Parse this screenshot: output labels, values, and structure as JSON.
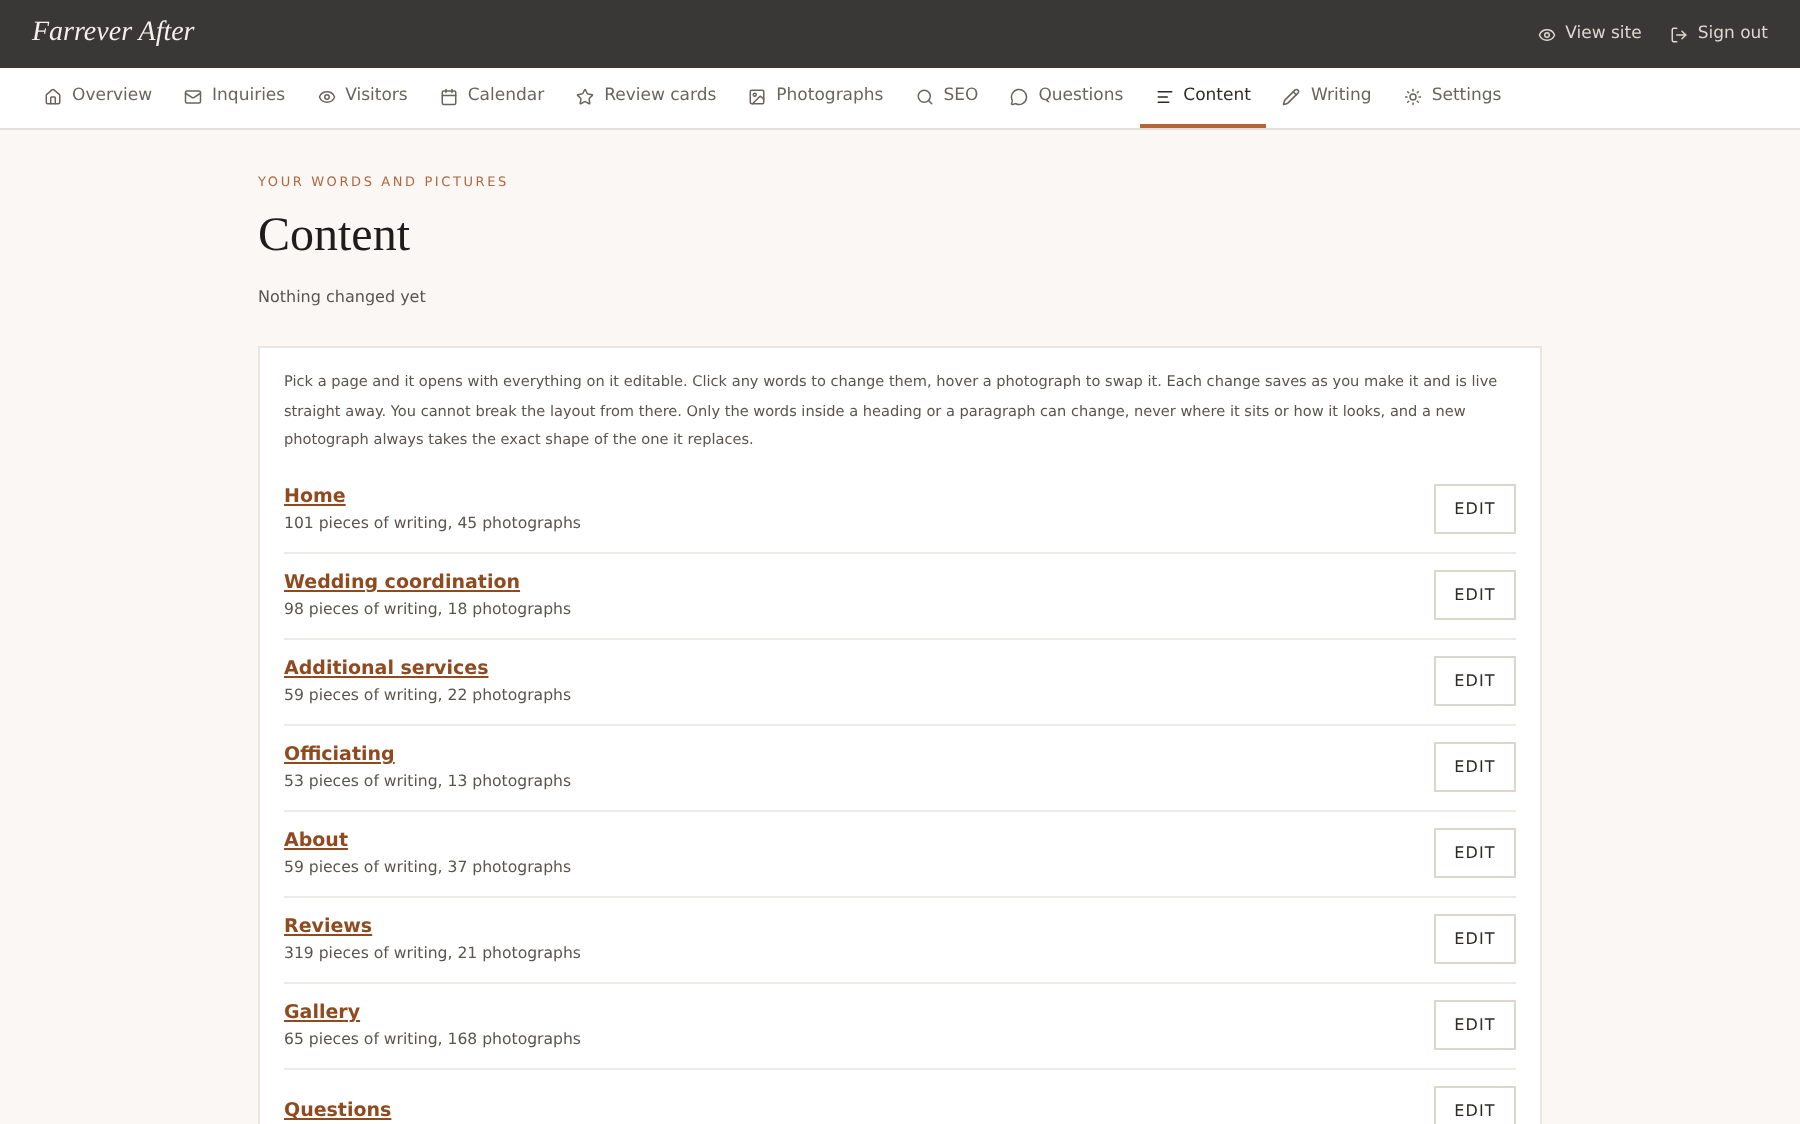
{
  "header": {
    "brand": "Farrever After",
    "links": [
      {
        "kind": "view",
        "label": "View site"
      },
      {
        "kind": "signout",
        "label": "Sign out"
      }
    ]
  },
  "tabs": [
    {
      "kind": "home",
      "label": "Overview",
      "selected": false
    },
    {
      "kind": "mail",
      "label": "Inquiries",
      "selected": false
    },
    {
      "kind": "eye",
      "label": "Visitors",
      "selected": false
    },
    {
      "kind": "calendar",
      "label": "Calendar",
      "selected": false
    },
    {
      "kind": "star",
      "label": "Review cards",
      "selected": false
    },
    {
      "kind": "image",
      "label": "Photographs",
      "selected": false
    },
    {
      "kind": "search",
      "label": "SEO",
      "selected": false
    },
    {
      "kind": "message",
      "label": "Questions",
      "selected": false
    },
    {
      "kind": "lines",
      "label": "Content",
      "selected": true
    },
    {
      "kind": "pencil",
      "label": "Writing",
      "selected": false
    },
    {
      "kind": "settings",
      "label": "Settings",
      "selected": false
    }
  ],
  "page": {
    "eyebrow": "YOUR WORDS AND PICTURES",
    "title": "Content",
    "status": "Nothing changed yet"
  },
  "intro": "Pick a page and it opens with everything on it editable. Click any words to change them, hover a photograph to swap it. Each change saves as you make it and is live straight away. You cannot break the layout from there. Only the words inside a heading or a paragraph can change, never where it sits or how it looks, and a new photograph always takes the exact shape of the one it replaces.",
  "pages": [
    {
      "name": "Home",
      "summary": "101 pieces of writing, 45 photographs",
      "action": "EDIT"
    },
    {
      "name": "Wedding coordination",
      "summary": "98 pieces of writing, 18 photographs",
      "action": "EDIT"
    },
    {
      "name": "Additional services",
      "summary": "59 pieces of writing, 22 photographs",
      "action": "EDIT"
    },
    {
      "name": "Officiating",
      "summary": "53 pieces of writing, 13 photographs",
      "action": "EDIT"
    },
    {
      "name": "About",
      "summary": "59 pieces of writing, 37 photographs",
      "action": "EDIT"
    },
    {
      "name": "Reviews",
      "summary": "319 pieces of writing, 21 photographs",
      "action": "EDIT"
    },
    {
      "name": "Gallery",
      "summary": "65 pieces of writing, 168 photographs",
      "action": "EDIT"
    },
    {
      "name": "Questions",
      "action": "EDIT"
    }
  ]
}
